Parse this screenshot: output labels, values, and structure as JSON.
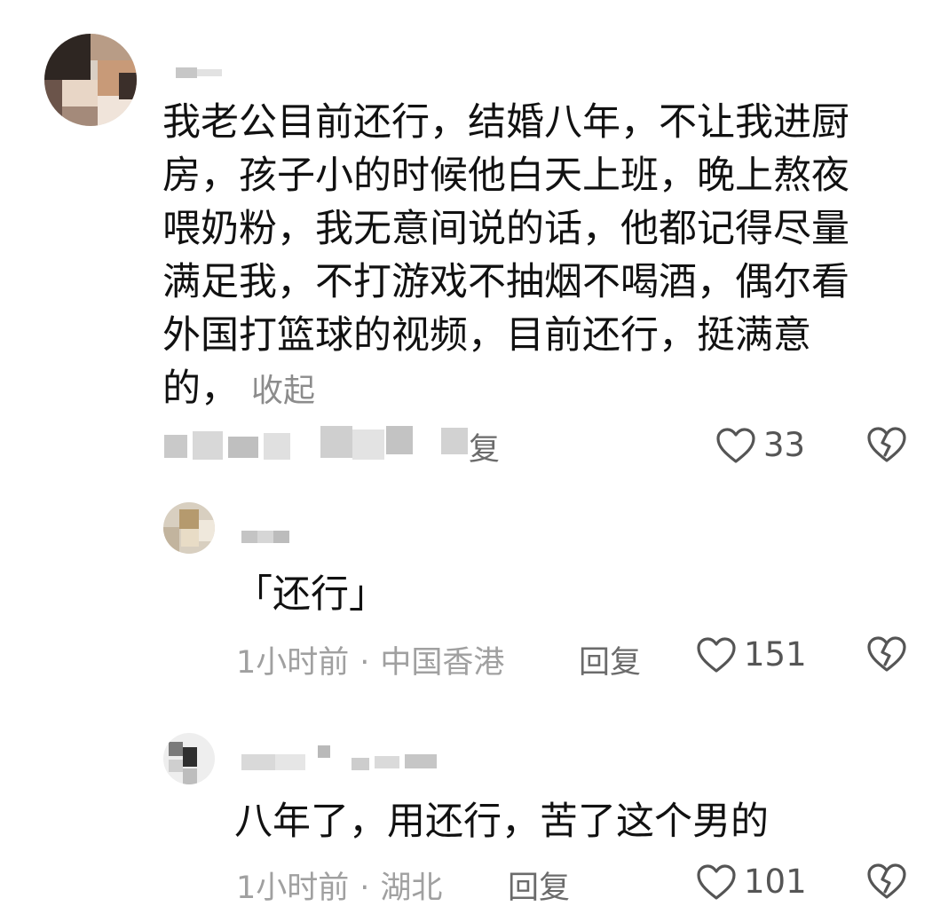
{
  "comment": {
    "text": "我老公目前还行，结婚八年，不让我进厨\n房，孩子小的时候他白天上班，晚上熬夜\n喂奶粉，我无意间说的话，他都记得尽量\n满足我，不打游戏不抽烟不喝酒，偶尔看\n外国打篮球的视频，目前还行，挺满意\n的，",
    "collapse_label": "收起",
    "like_count": "33",
    "reply_fragment": "复"
  },
  "replies": [
    {
      "text": "「还行」",
      "time": "1小时前",
      "location": "中国香港",
      "reply_label": "回复",
      "like_count": "151"
    },
    {
      "text": "八年了，用还行，苦了这个男的",
      "time": "1小时前",
      "location": "湖北",
      "reply_label": "回复",
      "like_count": "101"
    }
  ],
  "separator": "·",
  "colors": {
    "text": "#111111",
    "meta": "#a0a0a0",
    "icon": "#555555"
  },
  "icons": {
    "like": "heart-outline-icon",
    "dislike": "broken-heart-icon"
  }
}
